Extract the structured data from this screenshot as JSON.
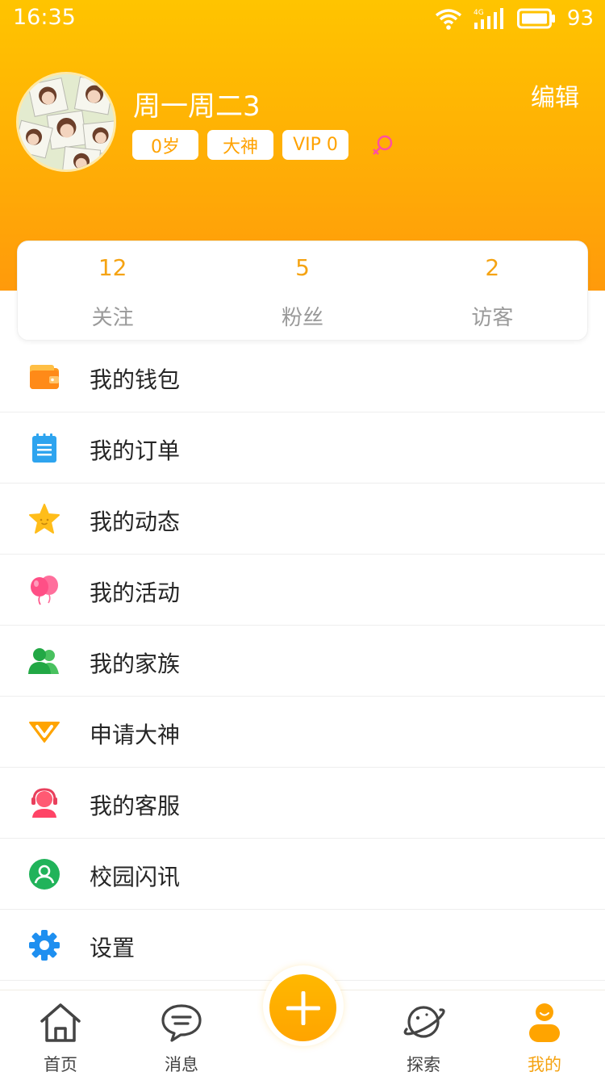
{
  "status_bar": {
    "time": "16:35",
    "network": "4G",
    "battery": "93"
  },
  "profile": {
    "nickname": "周一周二3",
    "tags": {
      "age": "0岁",
      "rank": "大神",
      "vip": "VIP 0"
    },
    "edit_label": "编辑",
    "gender_icon": "female-icon"
  },
  "stats": [
    {
      "value": "12",
      "label": "关注"
    },
    {
      "value": "5",
      "label": "粉丝"
    },
    {
      "value": "2",
      "label": "访客"
    }
  ],
  "menu": [
    {
      "label": "我的钱包",
      "icon": "wallet-icon"
    },
    {
      "label": "我的订单",
      "icon": "order-icon"
    },
    {
      "label": "我的动态",
      "icon": "star-icon"
    },
    {
      "label": "我的活动",
      "icon": "balloon-icon"
    },
    {
      "label": "我的家族",
      "icon": "family-icon"
    },
    {
      "label": "申请大神",
      "icon": "vip-v-icon"
    },
    {
      "label": "我的客服",
      "icon": "customer-service-icon"
    },
    {
      "label": "校园闪讯",
      "icon": "campus-news-icon"
    },
    {
      "label": "设置",
      "icon": "settings-icon"
    }
  ],
  "tabbar": {
    "home": "首页",
    "messages": "消息",
    "explore": "探索",
    "mine": "我的",
    "active": "mine"
  },
  "colors": {
    "accent": "#ffa400",
    "accent_text": "#f5a312",
    "header_top": "#ffc400",
    "header_bottom": "#ff9a0b"
  }
}
